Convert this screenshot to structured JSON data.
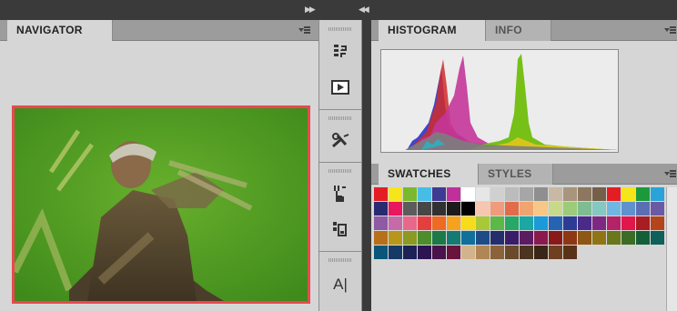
{
  "navigator": {
    "tab_label": "NAVIGATOR"
  },
  "histogram_panel": {
    "tabs": [
      "HISTOGRAM",
      "INFO"
    ]
  },
  "swatches_panel": {
    "tabs": [
      "SWATCHES",
      "STYLES"
    ]
  },
  "toolstrip": {
    "icons": [
      "history-icon",
      "play-action-icon",
      "tools-icon",
      "clone-source-icon",
      "brush-presets-icon",
      "character-icon"
    ],
    "text_tool_glyph": "A|"
  },
  "swatches": [
    "#e41d25",
    "#f6e51a",
    "#7ab92d",
    "#47bde6",
    "#3e3b93",
    "#c0309a",
    "#ffffff",
    "#e6e6e6",
    "#d0d0d0",
    "#bcbcbc",
    "#a6a6a6",
    "#8f8f8f",
    "#c8b8a4",
    "#a8957c",
    "#8d7760",
    "#746048",
    "#e41d25",
    "#f6e51a",
    "#1c9a3b",
    "#2aa3d9",
    "#2a2a72",
    "#e8175e",
    "#5c5c5c",
    "#474747",
    "#313131",
    "#1c1c1c",
    "#000000",
    "#f7c6b0",
    "#f09b7c",
    "#e46b4a",
    "#f0a470",
    "#f6c785",
    "#c8d98a",
    "#9ccc79",
    "#7fbc92",
    "#84c8c2",
    "#6fb7e3",
    "#5e92cc",
    "#5a6eb4",
    "#6a5aa5",
    "#8d5aa3",
    "#c66aa8",
    "#e8688c",
    "#e43f3e",
    "#ef6a22",
    "#f7a21c",
    "#f6dc1a",
    "#a8c83a",
    "#5cb847",
    "#27a866",
    "#1ba7a2",
    "#1a9ad8",
    "#2564b2",
    "#2c3c95",
    "#4b2a8a",
    "#7d2983",
    "#b42367",
    "#e1164b",
    "#a81d22",
    "#b4451b",
    "#b86f1a",
    "#b8961a",
    "#8a9a22",
    "#4d8d2e",
    "#1c7a46",
    "#167a74",
    "#116f9c",
    "#1d4b85",
    "#252d6e",
    "#3a1d69",
    "#5c1c62",
    "#8a1a4e",
    "#8a1a1a",
    "#8e3714",
    "#8e5714",
    "#8f7516",
    "#6a771b",
    "#3c6c25",
    "#145f37",
    "#0f5f5a",
    "#0a567a",
    "#163a68",
    "#1c2256",
    "#2c1551",
    "#48144b",
    "#6a133c",
    "#d2b48c",
    "#b08656",
    "#8c6239",
    "#6a4a2a",
    "#4c3420",
    "#3a2617",
    "#6e4020",
    "#5a3218"
  ]
}
